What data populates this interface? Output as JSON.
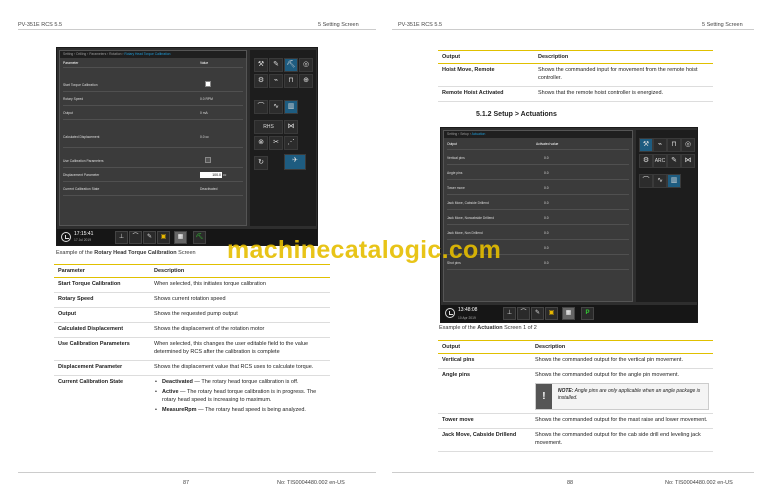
{
  "header": {
    "left_doc": "PV-351E RCS 5.5",
    "left_section": "5 Setting Screen",
    "right_doc": "PV-351E RCS 5.5",
    "right_section": "5 Setting Screen"
  },
  "footer": {
    "left_page": "87",
    "left_doc_no": "No: TIS0004480.002 en-US",
    "right_page": "88",
    "right_doc_no": "No: TIS0004480.002 en-US"
  },
  "watermark": "machinecatalogic.com",
  "screen1": {
    "breadcrumb": "Setting › Drilling › Parameters › Rotation ›",
    "breadcrumb_active": "Rotary Head Torque Calibration",
    "rows": [
      {
        "label": "Parameter",
        "value": "Value"
      },
      {
        "label": "Start Torque Calibration",
        "value": ""
      },
      {
        "label": "Rotary Speed",
        "value": "0.0 RPM"
      },
      {
        "label": "Output",
        "value": "0 mA"
      },
      {
        "label": "Calculated Displacement",
        "value": "0.0 cc"
      },
      {
        "label": "Use Calibration Parameters",
        "value": ""
      },
      {
        "label": "Displacement Parameter",
        "value": ""
      },
      {
        "label": "Current Calibration State",
        "value": "Deactivated"
      }
    ],
    "input_value": "100.0",
    "input_unit": "cc",
    "time": "17:15:41",
    "date": "17 Jul 2019",
    "icons": [
      "drill-icon",
      "wrench-icon",
      "tool-icon",
      "target-icon",
      "carriage-icon",
      "wave-icon",
      "mast-icon",
      "rhs-icon",
      "split-icon",
      "spray-icon",
      "refresh-icon",
      "fan-icon"
    ],
    "rhs_label": "RHS"
  },
  "caption1": {
    "prefix": "Example of the ",
    "bold": "Rotary Head Torque Calibration",
    "suffix": " Screen"
  },
  "table1": {
    "headers": [
      "Parameter",
      "Description"
    ],
    "rows": [
      {
        "k": "Start Torque Calibration",
        "v": "When selected, this initiates torque calibration"
      },
      {
        "k": "Rotary Speed",
        "v": "Shows current rotation speed"
      },
      {
        "k": "Output",
        "v": "Shows the requested pump output"
      },
      {
        "k": "Calculated Displacement",
        "v": "Shows the displacement of the rotation motor"
      },
      {
        "k": "Use Calibration Parameters",
        "v": "When selected, this changes the user editable field to the value determined by RCS after the calibration is complete"
      },
      {
        "k": "Displacement Parameter",
        "v": "Shows the displacement value that RCS uses to calculate torque."
      },
      {
        "k": "Current Calibration State",
        "v": ""
      }
    ],
    "states": [
      {
        "name": "Deactivated",
        "desc": " — The rotary head torque calibration is off."
      },
      {
        "name": "Active",
        "desc": " — The rotary head torque calibration is in progress. The rotary head speed is increasing to maximum."
      },
      {
        "name": "MeasureRpm",
        "desc": " — The rotary head speed is being analyzed."
      }
    ]
  },
  "table2": {
    "headers": [
      "Output",
      "Description"
    ],
    "rows": [
      {
        "k": "Hoist Move, Remote",
        "v": "Shows the commanded input for movement from the remote hoist controller."
      },
      {
        "k": "Remote Hoist Activated",
        "v": "Shows that the remote hoist controller is energized."
      }
    ]
  },
  "section": "5.1.2 Setup > Actuations",
  "screen2": {
    "breadcrumb": "Setting › Setup ›",
    "breadcrumb_active": "Actuation",
    "header": {
      "label": "Output",
      "value": "Activated value"
    },
    "rows": [
      {
        "label": "Vertical pins",
        "value": "0.0"
      },
      {
        "label": "Angle pins",
        "value": "0.0"
      },
      {
        "label": "Tower move",
        "value": "0.0"
      },
      {
        "label": "Jack Move, Cabside Drillend",
        "value": "0.0"
      },
      {
        "label": "Jack Move, Noncabside Drillend",
        "value": "0.0"
      },
      {
        "label": "Jack Move, Non Drillend",
        "value": "0.0"
      },
      {
        "label": "",
        "value": "0.0"
      },
      {
        "label": "Shot pins",
        "value": "0.0"
      }
    ],
    "time": "13:48:08",
    "date": "10 Apr 2019",
    "arc_label": "ARC",
    "p_label": "P"
  },
  "caption2": {
    "prefix": "Example of the ",
    "bold": "Actuation",
    "suffix": " Screen 1 of 2"
  },
  "table3": {
    "headers": [
      "Output",
      "Description"
    ],
    "rows": [
      {
        "k": "Vertical pins",
        "v": "Shows the commanded output for the vertical pin movement."
      },
      {
        "k": "Angle pins",
        "v": "Shows the commanded output for the angle pin movement."
      },
      {
        "k": "Tower move",
        "v": "Shows the commanded output for the mast raise and lower movement."
      },
      {
        "k": "Jack Move, Cabside Drillend",
        "v": "Shows the commanded output for the cab side drill end leveling jack movement."
      }
    ],
    "note": {
      "mark": "!",
      "label": "NOTE:",
      "text": " Angle pins are only applicable when an angle package is installed."
    }
  }
}
